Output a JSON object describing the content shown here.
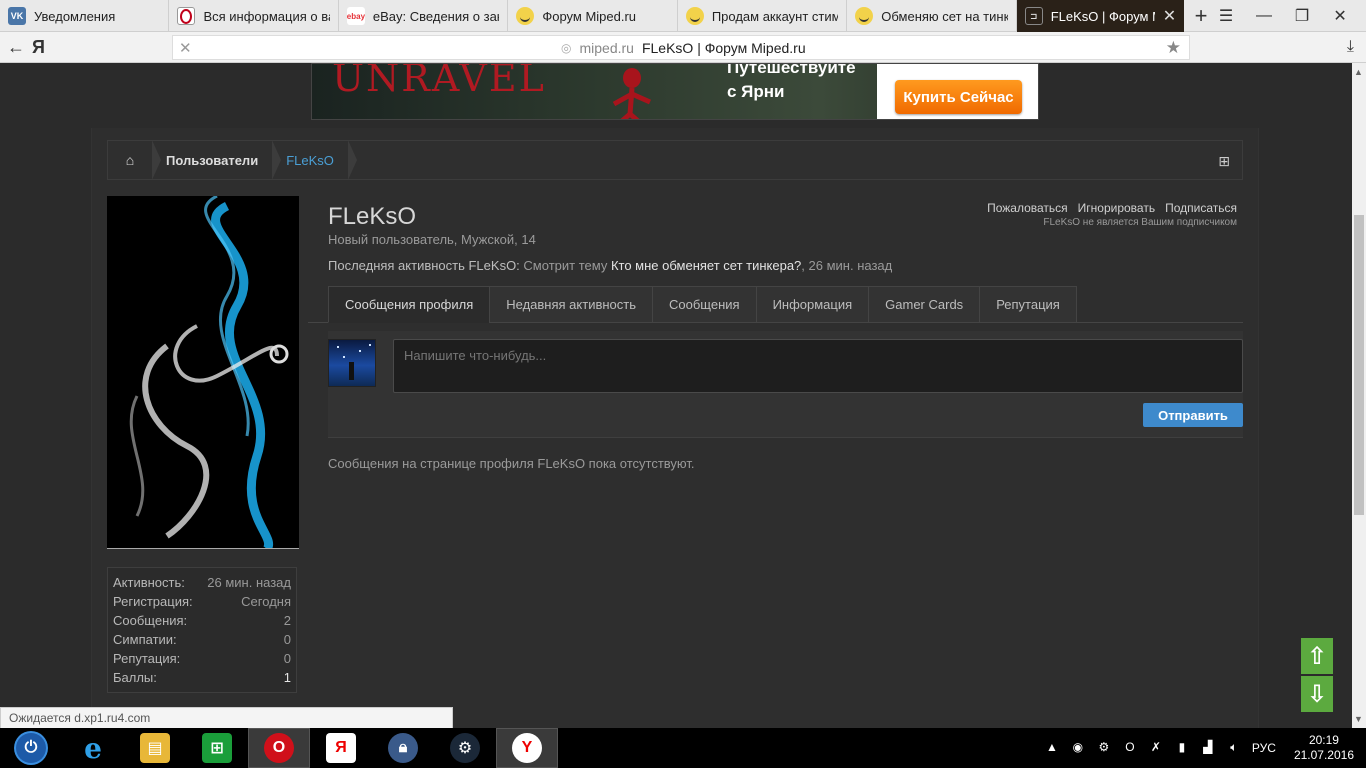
{
  "browser": {
    "tabs": [
      {
        "title": "Уведомления",
        "fav": "vk",
        "fav_text": "VK"
      },
      {
        "title": "Вся информация о ва",
        "fav": "opera",
        "fav_text": ""
      },
      {
        "title": "eBay: Сведения о зака",
        "fav": "ebay",
        "fav_text": "ebay"
      },
      {
        "title": "Форум Miped.ru",
        "fav": "face",
        "fav_text": ""
      },
      {
        "title": "Продам аккаунт стим",
        "fav": "face",
        "fav_text": ""
      },
      {
        "title": "Обменяю сет на тинкс",
        "fav": "face",
        "fav_text": ""
      }
    ],
    "active_tab": {
      "title": "FLeKsO | Форум Mip",
      "fav_text": "⊐"
    },
    "address": {
      "domain": "miped.ru",
      "title": "FLeKsO | Форум Miped.ru"
    },
    "status_text": "Ожидается d.xp1.ru4.com"
  },
  "banner": {
    "game_title": "UNRAVEL",
    "slogan_line1": "Путешествуйте",
    "slogan_line2": "с Ярни",
    "buy_label": "Купить Сейчас"
  },
  "breadcrumb": {
    "items": [
      "Пользователи"
    ],
    "current": "FLeKsO"
  },
  "profile": {
    "username": "FLeKsO",
    "info": "Новый пользователь, Мужской, 14",
    "last_activity": {
      "label": "Последняя активность FLeKsO:",
      "action": "Смотрит тему",
      "thread": "Кто мне обменяет сет тинкера?",
      "time": ", 26 мин. назад"
    },
    "actions": {
      "report": "Пожаловаться",
      "ignore": "Игнорировать",
      "follow": "Подписаться"
    },
    "follow_note": "FLeKsO не является Вашим подписчиком",
    "tabs": [
      "Сообщения профиля",
      "Недавняя активность",
      "Сообщения",
      "Информация",
      "Gamer Cards",
      "Репутация"
    ],
    "composer_placeholder": "Напишите что-нибудь...",
    "send_label": "Отправить",
    "empty_message": "Сообщения на странице профиля FLeKsO пока отсутствуют.",
    "stats": [
      {
        "label": "Активность:",
        "value": "26 мин. назад"
      },
      {
        "label": "Регистрация:",
        "value": "Сегодня"
      },
      {
        "label": "Сообщения:",
        "value": "2"
      },
      {
        "label": "Симпатии:",
        "value": "0"
      },
      {
        "label": "Репутация:",
        "value": "0"
      },
      {
        "label": "Баллы:",
        "value": "1"
      }
    ]
  },
  "taskbar": {
    "lang": "РУС",
    "time": "20:19",
    "date": "21.07.2016"
  },
  "colors": {
    "accent": "#3e8acc",
    "breadcrumb_current": "#4a9fd5",
    "scroll_buttons": "#5caa3f",
    "buy_button": "#f58a0a"
  }
}
